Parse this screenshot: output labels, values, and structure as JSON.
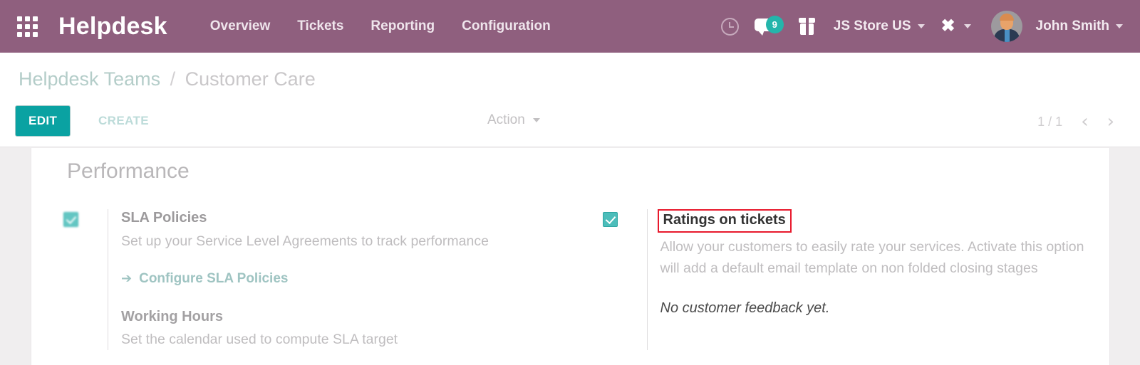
{
  "navbar": {
    "apps_icon": "apps-grid-icon",
    "brand": "Helpdesk",
    "menu": [
      {
        "label": "Overview"
      },
      {
        "label": "Tickets"
      },
      {
        "label": "Reporting"
      },
      {
        "label": "Configuration"
      }
    ],
    "icons": {
      "activity": "clock-icon",
      "messaging": "chat-bubble-icon",
      "gift": "gift-icon",
      "tools": "tools-icon"
    },
    "message_badge": "9",
    "company": "JS Store US",
    "user": "John Smith",
    "brand_color": "#8f5f7e",
    "badge_color": "#24b5ab"
  },
  "control_panel": {
    "breadcrumb": {
      "parent": "Helpdesk Teams",
      "separator": "/",
      "current": "Customer Care"
    },
    "edit_label": "EDIT",
    "create_label": "CREATE",
    "action_label": "Action",
    "pager_counter": "1 / 1",
    "prev_arrow": "‹",
    "next_arrow": "›"
  },
  "sheet": {
    "section_title": "Performance",
    "left_column": {
      "sla": {
        "checked": true,
        "title": "SLA Policies",
        "description": "Set up your Service Level Agreements to track performance",
        "link_arrow": "➔",
        "link_label": "Configure SLA Policies"
      },
      "working_hours": {
        "title": "Working Hours",
        "description": "Set the calendar used to compute SLA target"
      }
    },
    "right_column": {
      "ratings": {
        "checked": true,
        "title": "Ratings on tickets",
        "highlight_color": "#e8192c",
        "description": "Allow your customers to easily rate your services. Activate this option will add a default email template on non folded closing stages",
        "feedback": "No customer feedback yet."
      }
    }
  }
}
